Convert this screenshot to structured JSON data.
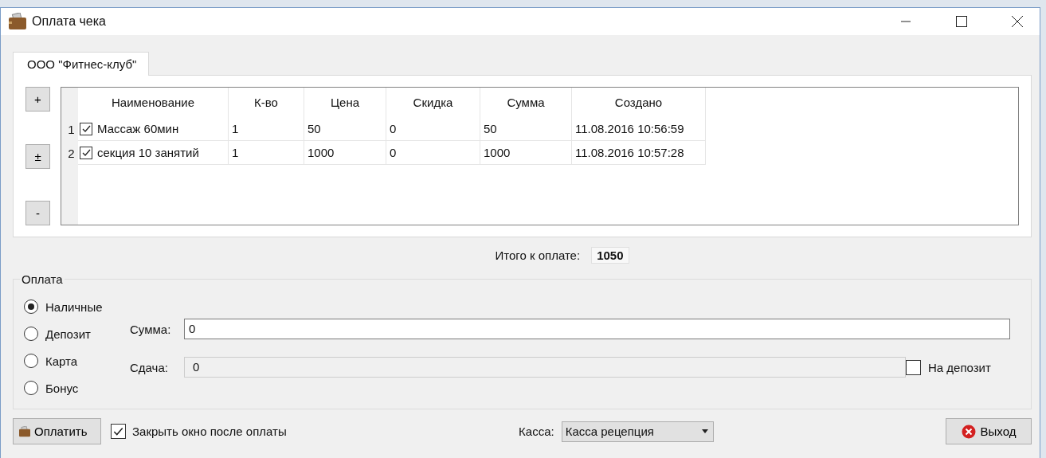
{
  "window": {
    "title": "Оплата чека"
  },
  "tabs": [
    {
      "label": "ООО \"Фитнес-клуб\"",
      "selected": true
    }
  ],
  "side_buttons": [
    "+",
    "±",
    "-"
  ],
  "table": {
    "columns": [
      "Наименование",
      "К-во",
      "Цена",
      "Скидка",
      "Сумма",
      "Создано"
    ],
    "rows": [
      {
        "number": "1",
        "checked": true,
        "cells": [
          "Массаж 60мин",
          "1",
          "50",
          "0",
          "50",
          "11.08.2016 10:56:59"
        ]
      },
      {
        "number": "2",
        "checked": true,
        "cells": [
          "секция 10 занятий",
          "1",
          "1000",
          "0",
          "1000",
          "11.08.2016 10:57:28"
        ]
      }
    ]
  },
  "total": {
    "label": "Итого к оплате:",
    "value": "1050"
  },
  "payment": {
    "title": "Оплата",
    "methods": [
      {
        "label": "Наличные",
        "selected": true
      },
      {
        "label": "Депозит",
        "selected": false
      },
      {
        "label": "Карта",
        "selected": false
      },
      {
        "label": "Бонус",
        "selected": false
      }
    ],
    "amount": {
      "label": "Сумма:",
      "value": "0"
    },
    "change": {
      "label": "Сдача:",
      "value": "0",
      "disabled": true
    },
    "to_deposit": {
      "label": "На депозит",
      "checked": false
    }
  },
  "footer": {
    "pay_button": "Оплатить",
    "close_after": {
      "label": "Закрыть окно после оплаты",
      "checked": true
    },
    "register": {
      "label": "Касса:",
      "value": "Касса рецепция"
    },
    "exit_button": "Выход"
  }
}
